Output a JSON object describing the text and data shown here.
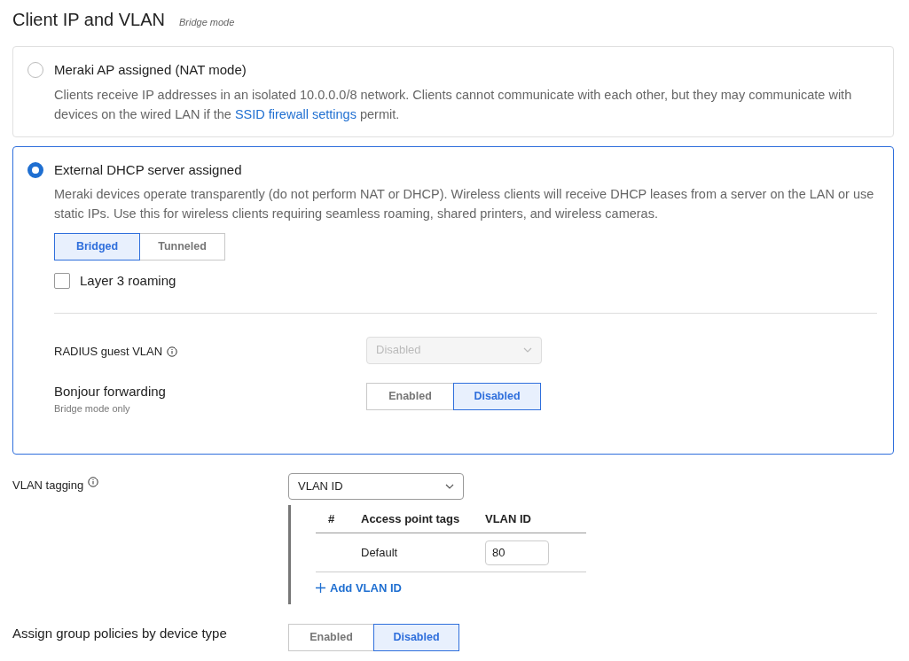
{
  "header": {
    "title": "Client IP and VLAN",
    "subtitle": "Bridge mode"
  },
  "options": [
    {
      "label": "Meraki AP assigned (NAT mode)",
      "selected": false,
      "description": "Clients receive IP addresses in an isolated 10.0.0.0/8 network. Clients cannot communicate with each other, but they may communicate with devices on the wired LAN if the",
      "link": "SSID firewall settings",
      "description_end": "permit."
    },
    {
      "label": "External DHCP server assigned",
      "selected": true,
      "description": "Meraki devices operate transparently (do not perform NAT or DHCP). Wireless clients will receive DHCP leases from a server on the LAN or use static IPs. Use this for wireless clients requiring seamless roaming, shared printers, and wireless cameras.",
      "mode_toggle": [
        {
          "label": "Bridged",
          "selected": true
        },
        {
          "label": "Tunneled",
          "selected": false
        }
      ],
      "layer3_roaming": {
        "label": "Layer 3 roaming",
        "checked": false
      },
      "radius_guest_vlan": {
        "label": "RADIUS guest VLAN",
        "value": "Disabled",
        "disabled": true
      },
      "bonjour_forwarding": {
        "label": "Bonjour forwarding",
        "hint": "Bridge mode only",
        "toggle": [
          {
            "label": "Enabled",
            "selected": false
          },
          {
            "label": "Disabled",
            "selected": true
          }
        ]
      }
    }
  ],
  "vlan_tagging": {
    "label": "VLAN tagging",
    "value": "VLAN ID",
    "table": {
      "columns": [
        "#",
        "Access point tags",
        "VLAN ID"
      ],
      "rows": [
        {
          "tags": "Default",
          "vlan_id": "80"
        }
      ]
    },
    "add_link": "Add VLAN ID"
  },
  "group_policies": {
    "label": "Assign group policies by device type",
    "toggle": [
      {
        "label": "Enabled",
        "selected": false
      },
      {
        "label": "Disabled",
        "selected": true
      }
    ]
  }
}
